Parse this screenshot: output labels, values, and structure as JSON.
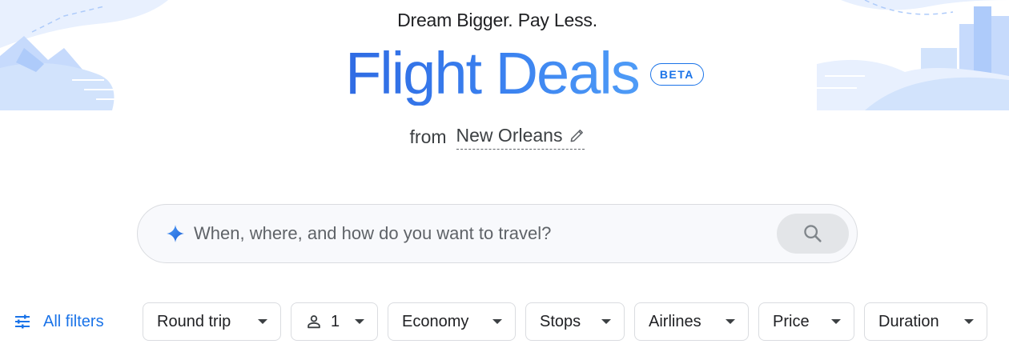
{
  "header": {
    "tagline": "Dream Bigger. Pay Less.",
    "title": "Flight Deals",
    "badge": "BETA"
  },
  "origin": {
    "label": "from",
    "city": "New Orleans",
    "edit_icon": "pencil-icon"
  },
  "search": {
    "placeholder": "When, where, and how do you want to travel?",
    "leading_icon": "sparkle-icon",
    "button_icon": "search-icon"
  },
  "filters": {
    "all_filters_label": "All filters",
    "all_filters_icon": "tune-icon",
    "trip_type": "Round trip",
    "passengers": "1",
    "passenger_icon": "person-icon",
    "cabin_class": "Economy",
    "stops": "Stops",
    "airlines": "Airlines",
    "price": "Price",
    "duration": "Duration"
  },
  "colors": {
    "accent": "#1a73e8",
    "title_gradient_start": "#2f6be3",
    "title_gradient_end": "#4f9cf7",
    "decor_light": "#d2e3fc"
  }
}
